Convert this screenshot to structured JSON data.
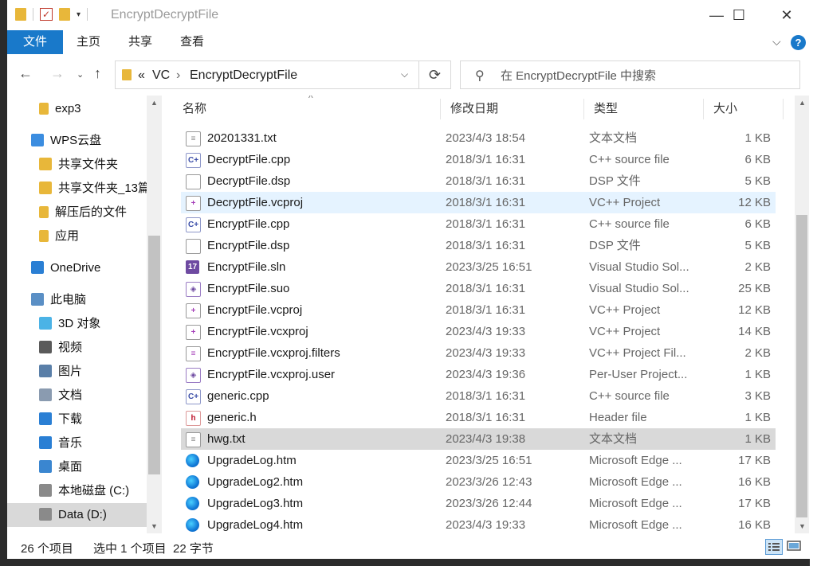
{
  "window": {
    "title": "EncryptDecryptFile",
    "minimize": "—",
    "maximize": "☐",
    "close": "✕"
  },
  "ribbon": {
    "tabs": [
      "文件",
      "主页",
      "共享",
      "查看"
    ],
    "expand_icon": "chevron-down-icon",
    "help": "?"
  },
  "address": {
    "overflow": "«",
    "crumbs": [
      "VC",
      "EncryptDecryptFile"
    ],
    "separator": "›"
  },
  "search": {
    "placeholder": "在 EncryptDecryptFile 中搜索"
  },
  "nav": {
    "items": [
      {
        "label": "exp3",
        "icon": "folder-icon"
      },
      {
        "label": "WPS云盘",
        "icon": "cloud-icon"
      },
      {
        "label": "共享文件夹",
        "icon": "shared-folder-icon"
      },
      {
        "label": "共享文件夹_13篇",
        "icon": "shared-folder-icon"
      },
      {
        "label": "解压后的文件",
        "icon": "folder-icon"
      },
      {
        "label": "应用",
        "icon": "folder-icon"
      },
      {
        "label": "OneDrive",
        "icon": "onedrive-icon"
      },
      {
        "label": "此电脑",
        "icon": "computer-icon"
      },
      {
        "label": "3D 对象",
        "icon": "3d-objects-icon"
      },
      {
        "label": "视频",
        "icon": "video-icon"
      },
      {
        "label": "图片",
        "icon": "pictures-icon"
      },
      {
        "label": "文档",
        "icon": "documents-icon"
      },
      {
        "label": "下载",
        "icon": "download-icon"
      },
      {
        "label": "音乐",
        "icon": "music-icon"
      },
      {
        "label": "桌面",
        "icon": "desktop-icon"
      },
      {
        "label": "本地磁盘 (C:)",
        "icon": "drive-icon"
      },
      {
        "label": "Data (D:)",
        "icon": "drive-icon"
      }
    ]
  },
  "columns": {
    "name": "名称",
    "date": "修改日期",
    "type": "类型",
    "size": "大小"
  },
  "files": [
    {
      "name": "20201331.txt",
      "date": "2023/4/3 18:54",
      "type": "文本文档",
      "size": "1 KB",
      "icon": "text-file-icon"
    },
    {
      "name": "DecryptFile.cpp",
      "date": "2018/3/1 16:31",
      "type": "C++ source file",
      "size": "6 KB",
      "icon": "cpp-file-icon"
    },
    {
      "name": "DecryptFile.dsp",
      "date": "2018/3/1 16:31",
      "type": "DSP 文件",
      "size": "5 KB",
      "icon": "blank-file-icon"
    },
    {
      "name": "DecryptFile.vcproj",
      "date": "2018/3/1 16:31",
      "type": "VC++ Project",
      "size": "12 KB",
      "icon": "vcproj-file-icon"
    },
    {
      "name": "EncryptFile.cpp",
      "date": "2018/3/1 16:31",
      "type": "C++ source file",
      "size": "6 KB",
      "icon": "cpp-file-icon"
    },
    {
      "name": "EncryptFile.dsp",
      "date": "2018/3/1 16:31",
      "type": "DSP 文件",
      "size": "5 KB",
      "icon": "blank-file-icon"
    },
    {
      "name": "EncryptFile.sln",
      "date": "2023/3/25 16:51",
      "type": "Visual Studio Sol...",
      "size": "2 KB",
      "icon": "sln-file-icon"
    },
    {
      "name": "EncryptFile.suo",
      "date": "2018/3/1 16:31",
      "type": "Visual Studio Sol...",
      "size": "25 KB",
      "icon": "suo-file-icon"
    },
    {
      "name": "EncryptFile.vcproj",
      "date": "2018/3/1 16:31",
      "type": "VC++ Project",
      "size": "12 KB",
      "icon": "vcproj-file-icon"
    },
    {
      "name": "EncryptFile.vcxproj",
      "date": "2023/4/3 19:33",
      "type": "VC++ Project",
      "size": "14 KB",
      "icon": "vcxproj-file-icon"
    },
    {
      "name": "EncryptFile.vcxproj.filters",
      "date": "2023/4/3 19:33",
      "type": "VC++ Project Fil...",
      "size": "2 KB",
      "icon": "filters-file-icon"
    },
    {
      "name": "EncryptFile.vcxproj.user",
      "date": "2023/4/3 19:36",
      "type": "Per-User Project...",
      "size": "1 KB",
      "icon": "user-file-icon"
    },
    {
      "name": "generic.cpp",
      "date": "2018/3/1 16:31",
      "type": "C++ source file",
      "size": "3 KB",
      "icon": "cpp-file-icon"
    },
    {
      "name": "generic.h",
      "date": "2018/3/1 16:31",
      "type": "Header file",
      "size": "1 KB",
      "icon": "header-file-icon"
    },
    {
      "name": "hwg.txt",
      "date": "2023/4/3 19:38",
      "type": "文本文档",
      "size": "1 KB",
      "icon": "text-file-icon"
    },
    {
      "name": "UpgradeLog.htm",
      "date": "2023/3/25 16:51",
      "type": "Microsoft Edge ...",
      "size": "17 KB",
      "icon": "edge-icon"
    },
    {
      "name": "UpgradeLog2.htm",
      "date": "2023/3/26 12:43",
      "type": "Microsoft Edge ...",
      "size": "16 KB",
      "icon": "edge-icon"
    },
    {
      "name": "UpgradeLog3.htm",
      "date": "2023/3/26 12:44",
      "type": "Microsoft Edge ...",
      "size": "17 KB",
      "icon": "edge-icon"
    },
    {
      "name": "UpgradeLog4.htm",
      "date": "2023/4/3 19:33",
      "type": "Microsoft Edge ...",
      "size": "16 KB",
      "icon": "edge-icon"
    }
  ],
  "status": {
    "count": "26 个项目",
    "selection": "选中 1 个项目",
    "size": "22 字节"
  }
}
